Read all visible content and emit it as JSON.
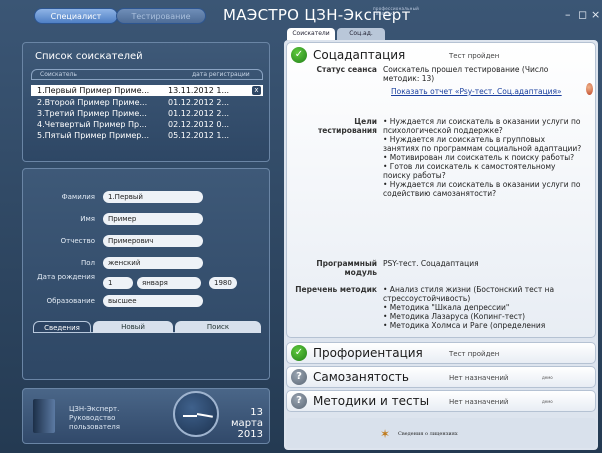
{
  "top": {
    "segments": [
      "Специалист",
      "Тестирование"
    ],
    "title": "МАЭСТРО ЦЗН-Эксперт",
    "title_sup": "профессиональный комплекс",
    "win_buttons": [
      "–",
      "◻",
      "×"
    ]
  },
  "seekers": {
    "title": "Список соискателей",
    "col_name": "Соискатель",
    "col_date": "дата регистрации",
    "rows": [
      {
        "name": "1.Первый Пример Приме...",
        "date": "13.11.2012 1...",
        "selected": true
      },
      {
        "name": "2.Второй Пример Приме...",
        "date": "01.12.2012 2..."
      },
      {
        "name": "3.Третий Пример Приме...",
        "date": "01.12.2012 2..."
      },
      {
        "name": "4.Четвертый Пример Пр...",
        "date": "02.12.2012 0..."
      },
      {
        "name": "5.Пятый Пример Пример...",
        "date": "05.12.2012 1..."
      }
    ],
    "remove_glyph": "x"
  },
  "form": {
    "surname_label": "Фамилия",
    "surname": "1.Первый",
    "name_label": "Имя",
    "name": "Пример",
    "patronymic_label": "Отчество",
    "patronymic": "Примерович",
    "sex_label": "Пол",
    "sex": "женский",
    "birth_label": "Дата рождения",
    "birth_day": "1",
    "birth_month": "января",
    "birth_year": "1980",
    "education_label": "Образование",
    "education": "высшее",
    "tabs": [
      "Сведения",
      "Новый",
      "Поиск"
    ]
  },
  "footer": {
    "manual": "ЦЗН-Эксперт. Руководство пользователя",
    "date_day": "13 марта",
    "date_year": "2013"
  },
  "right_tabs": [
    "Соискатели",
    "Соц.ад."
  ],
  "cards": [
    {
      "title": "Соцадаптация",
      "status": "Тест пройден",
      "icon": "check"
    },
    {
      "title": "Профориентация",
      "status": "Тест пройден",
      "icon": "check"
    },
    {
      "title": "Самозанятость",
      "status": "Нет назначений",
      "extra": "демо",
      "icon": "question"
    },
    {
      "title": "Методики и тесты",
      "status": "Нет назначений",
      "extra": "демо",
      "icon": "question"
    }
  ],
  "details": {
    "session_label": "Статус сеанса",
    "session_text": "Соискатель прошел тестирование (Число методик: 13)",
    "report_link": "Показать отчет «Psy-тест. Соц.адаптация»",
    "goals_label": "Цели тестирования",
    "goals": [
      "• Нуждается ли соискатель в оказании услуги по психологической поддержке?",
      "• Нуждается ли соискатель в групповых занятиях по программам социальной адаптации?",
      "• Мотивирован ли соискатель к поиску работы?",
      "• Готов ли соискатель к самостоятельному поиску работы?",
      "• Нуждается ли соискатель в оказании услуги по содействию самозанятости?"
    ],
    "module_label": "Программный модуль",
    "module_text": "PSY-тест. Соцадаптация",
    "methods_label": "Перечень методик",
    "methods": [
      "• Анализ стиля жизни (Бостонский тест на стрессоустойчивость)",
      "• Методика \"Шкала депрессии\"",
      "• Методика Лазаруса (Копинг-тест)",
      "• Методика Холмса и Раге (определения"
    ]
  },
  "bottom": {
    "text": "Сведения о лицензиях"
  }
}
